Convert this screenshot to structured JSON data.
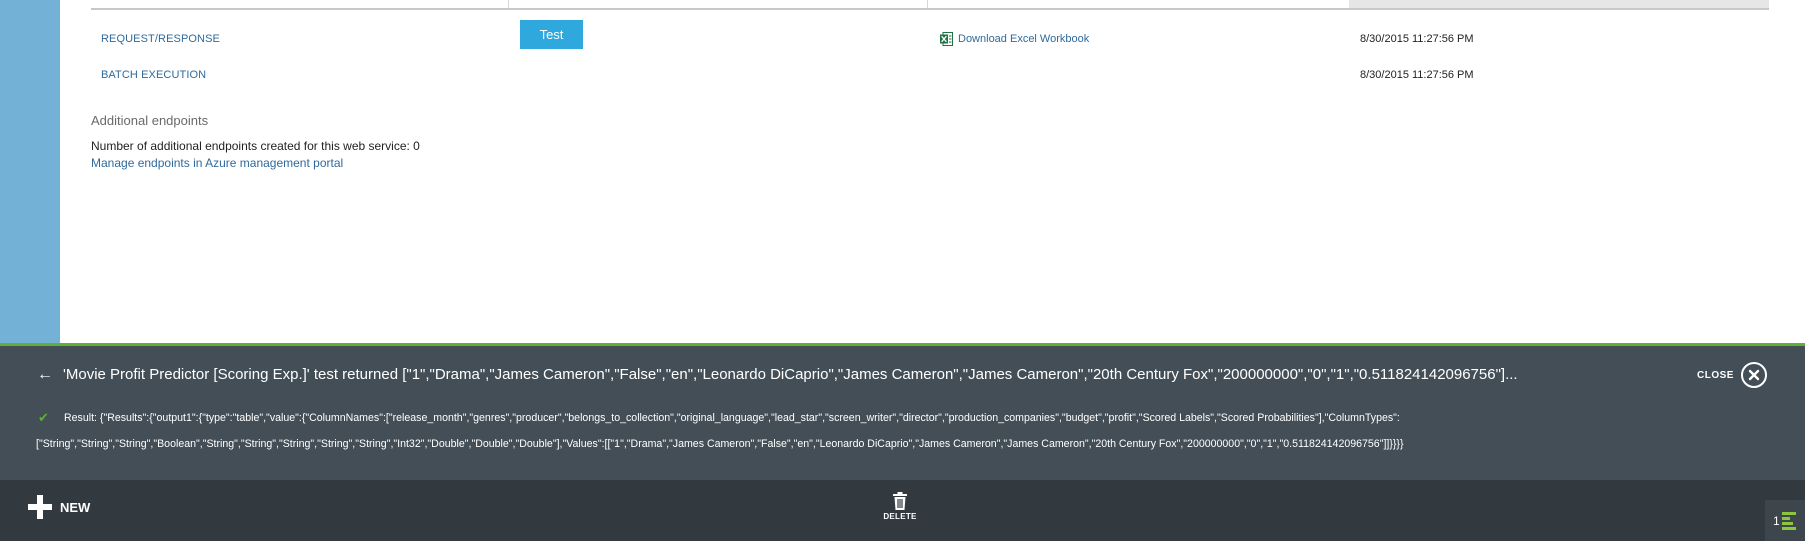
{
  "endpoints": {
    "request_response": {
      "name": "REQUEST/RESPONSE",
      "test_label": "Test",
      "excel_label": "Download Excel Workbook",
      "last_updated": "8/30/2015 11:27:56 PM"
    },
    "batch_execution": {
      "name": "BATCH EXECUTION",
      "last_updated": "8/30/2015 11:27:56 PM"
    }
  },
  "additional": {
    "title": "Additional endpoints",
    "count_text": "Number of additional endpoints created for this web service: 0",
    "manage_link": "Manage endpoints in Azure management portal"
  },
  "notification": {
    "message": "'Movie Profit Predictor [Scoring Exp.]' test returned [\"1\",\"Drama\",\"James Cameron\",\"False\",\"en\",\"Leonardo DiCaprio\",\"James Cameron\",\"James Cameron\",\"20th Century Fox\",\"200000000\",\"0\",\"1\",\"0.511824142096756\"]...",
    "close_label": "CLOSE",
    "result_line1": "Result: {\"Results\":{\"output1\":{\"type\":\"table\",\"value\":{\"ColumnNames\":[\"release_month\",\"genres\",\"producer\",\"belongs_to_collection\",\"original_language\",\"lead_star\",\"screen_writer\",\"director\",\"production_companies\",\"budget\",\"profit\",\"Scored Labels\",\"Scored Probabilities\"],\"ColumnTypes\":",
    "result_line2": "[\"String\",\"String\",\"String\",\"Boolean\",\"String\",\"String\",\"String\",\"String\",\"String\",\"Int32\",\"Double\",\"Double\",\"Double\"],\"Values\":[[\"1\",\"Drama\",\"James Cameron\",\"False\",\"en\",\"Leonardo DiCaprio\",\"James Cameron\",\"James Cameron\",\"20th Century Fox\",\"200000000\",\"0\",\"1\",\"0.511824142096756\"]]}}}}"
  },
  "commandbar": {
    "new_label": "NEW",
    "delete_label": "DELETE",
    "activity_count": "1"
  },
  "colors": {
    "rail": "#73b2d6",
    "accent_green": "#5fb132",
    "link": "#2f6a9c",
    "button": "#2ea8dd",
    "notification_bg": "#434e57",
    "commandbar_bg": "#323a40"
  }
}
